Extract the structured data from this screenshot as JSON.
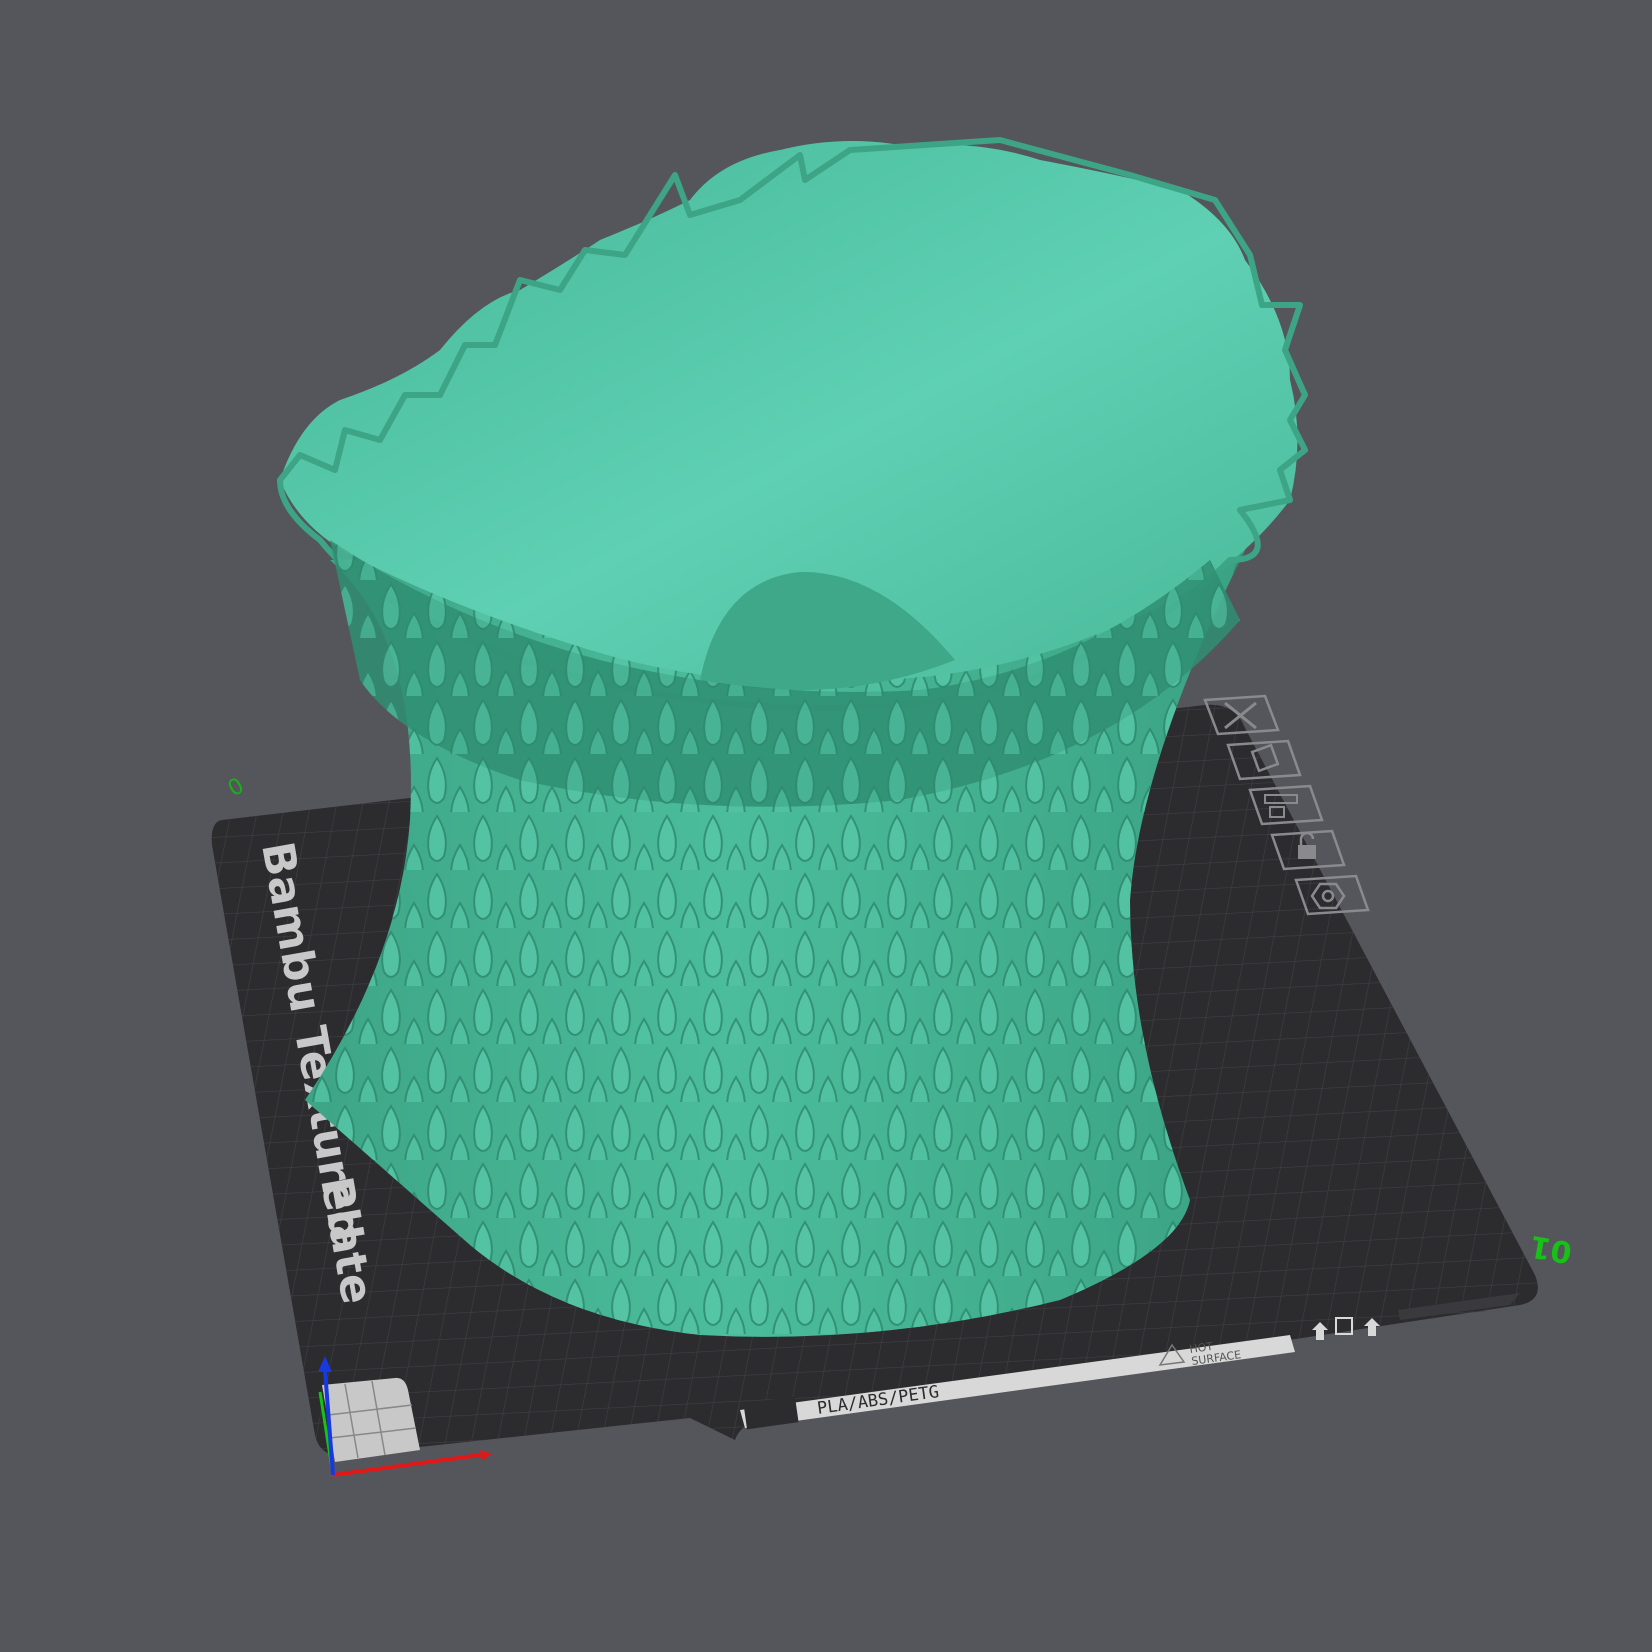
{
  "plate": {
    "texture_label": "Bambu Textured",
    "plate_word": "Plate",
    "material_label": "PLA/ABS/PETG",
    "warning_label_line1": "HOT",
    "warning_label_line2": "SURFACE",
    "corner_number": "01",
    "top_left_mark": "0"
  },
  "colors": {
    "background": "#55565c",
    "plate": "#2c2c2f",
    "grid": "#3c3c40",
    "model": "#4dc0a0",
    "axis_x": "#e01818",
    "axis_y": "#18c018",
    "axis_z": "#1838e0",
    "plate_number": "#18c018"
  },
  "plate_tools": [
    {
      "name": "delete",
      "icon": "close-icon"
    },
    {
      "name": "auto-orient",
      "icon": "orient-icon"
    },
    {
      "name": "arrange",
      "icon": "arrange-icon"
    },
    {
      "name": "lock",
      "icon": "lock-icon"
    },
    {
      "name": "settings",
      "icon": "gear-icon"
    }
  ]
}
